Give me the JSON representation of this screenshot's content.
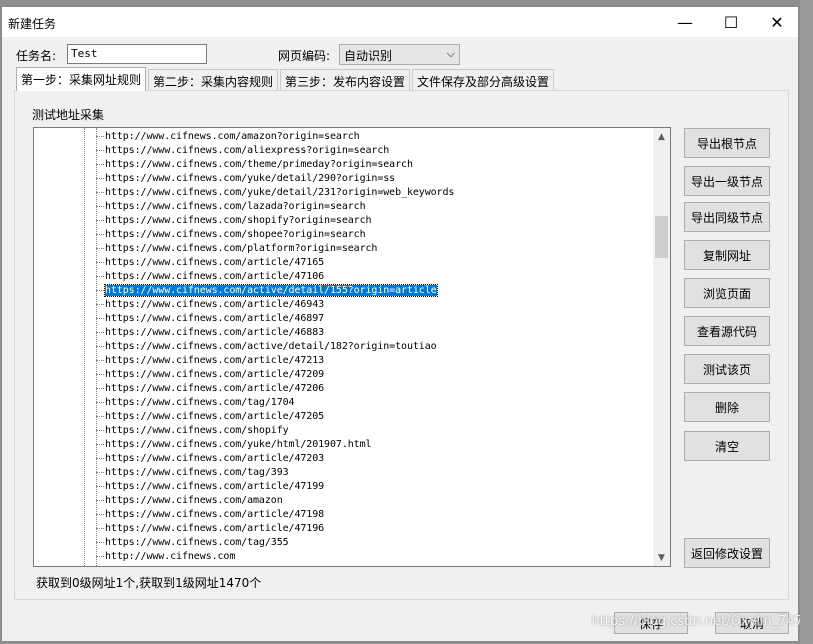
{
  "window": {
    "title": "新建任务"
  },
  "titlebar_buttons": {
    "minimize": "—",
    "maximize": "☐",
    "close": "✕"
  },
  "form": {
    "task_name_label": "任务名:",
    "task_name_value": "Test",
    "encoding_label": "网页编码:",
    "encoding_value": "自动识别"
  },
  "tabs": [
    {
      "label": "第一步：采集网址规则"
    },
    {
      "label": "第二步：采集内容规则"
    },
    {
      "label": "第三步：发布内容设置"
    },
    {
      "label": "文件保存及部分高级设置"
    }
  ],
  "section_label": "测试地址采集",
  "urls": [
    "http://www.cifnews.com/amazon?origin=search",
    "https://www.cifnews.com/aliexpress?origin=search",
    "https://www.cifnews.com/theme/primeday?origin=search",
    "https://www.cifnews.com/yuke/detail/290?origin=ss",
    "https://www.cifnews.com/yuke/detail/231?origin=web_keywords",
    "https://www.cifnews.com/lazada?origin=search",
    "https://www.cifnews.com/shopify?origin=search",
    "https://www.cifnews.com/shopee?origin=search",
    "https://www.cifnews.com/platform?origin=search",
    "https://www.cifnews.com/article/47165",
    "https://www.cifnews.com/article/47106",
    "https://www.cifnews.com/active/detail/155?origin=article",
    "https://www.cifnews.com/article/46943",
    "https://www.cifnews.com/article/46897",
    "https://www.cifnews.com/article/46883",
    "https://www.cifnews.com/active/detail/182?origin=toutiao",
    "https://www.cifnews.com/article/47213",
    "https://www.cifnews.com/article/47209",
    "https://www.cifnews.com/article/47206",
    "https://www.cifnews.com/tag/1704",
    "https://www.cifnews.com/article/47205",
    "https://www.cifnews.com/shopify",
    "https://www.cifnews.com/yuke/html/201907.html",
    "https://www.cifnews.com/article/47203",
    "https://www.cifnews.com/tag/393",
    "https://www.cifnews.com/article/47199",
    "https://www.cifnews.com/amazon",
    "https://www.cifnews.com/article/47198",
    "https://www.cifnews.com/article/47196",
    "https://www.cifnews.com/tag/355",
    "http://www.cifnews.com"
  ],
  "selected_index": 11,
  "side_buttons": [
    {
      "label": "导出根节点"
    },
    {
      "label": "导出一级节点"
    },
    {
      "label": "导出同级节点"
    },
    {
      "label": "复制网址"
    },
    {
      "label": "浏览页面"
    },
    {
      "label": "查看源代码"
    },
    {
      "label": "测试该页"
    },
    {
      "label": "删除"
    },
    {
      "label": "清空"
    }
  ],
  "back_button": "返回修改设置",
  "status_text": "获取到0级网址1个,获取到1级网址1470个",
  "bottom_buttons": {
    "save": "保存",
    "cancel": "取消"
  },
  "watermark": "https://blog.csdn.net/Oxylin_747"
}
